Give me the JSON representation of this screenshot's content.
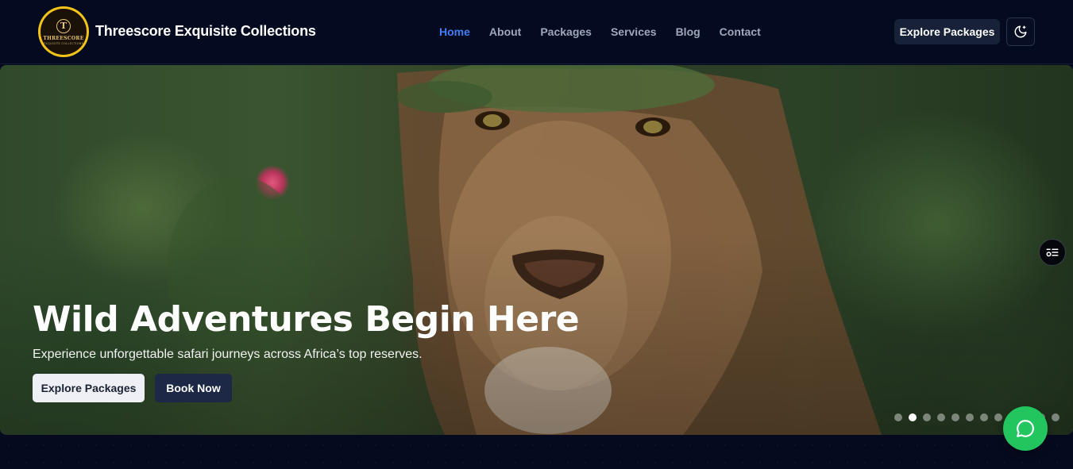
{
  "brand": {
    "logo_initial": "T",
    "logo_word": "THREESCORE",
    "logo_sub": "EXQUISITE COLLECTIONS",
    "name": "Threescore Exquisite Collections"
  },
  "nav": {
    "items": [
      {
        "label": "Home",
        "active": true
      },
      {
        "label": "About",
        "active": false
      },
      {
        "label": "Packages",
        "active": false
      },
      {
        "label": "Services",
        "active": false
      },
      {
        "label": "Blog",
        "active": false
      },
      {
        "label": "Contact",
        "active": false
      }
    ],
    "cta_label": "Explore Packages",
    "theme_toggle_icon": "moon-icon"
  },
  "hero": {
    "title": "Wild Adventures Begin Here",
    "subtitle": "Experience unforgettable safari journeys across Africa’s top reserves.",
    "primary_button": "Explore Packages",
    "secondary_button": "Book Now",
    "slides_total": 12,
    "slide_active": 2,
    "image_subject": "lion-photo"
  },
  "floating": {
    "side_icon": "settings-list-icon",
    "chat_icon": "chat-bubble-icon"
  },
  "colors": {
    "accent": "#3f7ef5",
    "nav_bg": "#040a1f",
    "chat": "#22c55e",
    "logo_ring": "#f2c41a"
  }
}
